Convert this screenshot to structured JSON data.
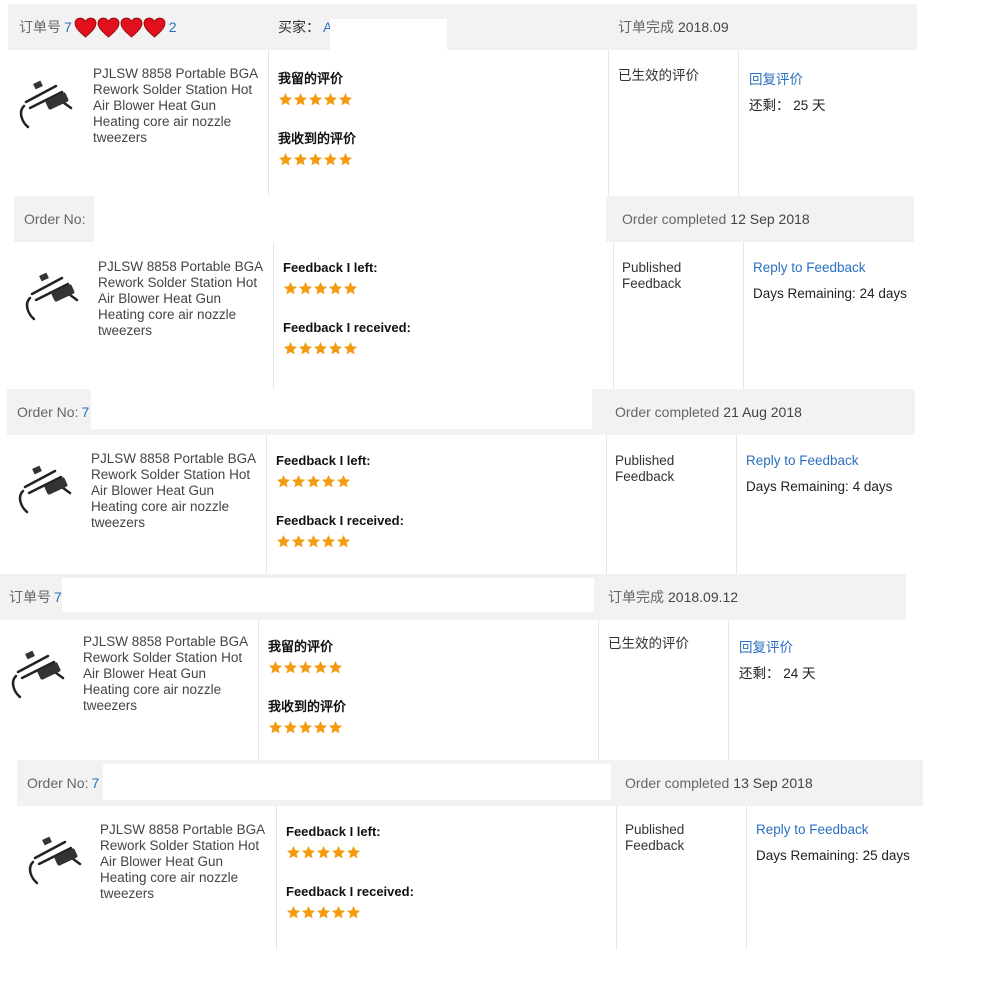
{
  "colors": {
    "link": "#2a6fbf",
    "star": "#f39c12",
    "header_bg": "#f2f2f2",
    "heart": "#e0101e"
  },
  "product_name_lines": [
    "PJLSW 8858 Portable BGA",
    "Rework Solder Station Hot",
    "Air Blower Heat Gun",
    "Heating core air nozzle",
    "tweezers"
  ],
  "orders": [
    {
      "order_label": "订单号",
      "order_value": "7",
      "order_suffix": "2",
      "buyer_label": "买家：",
      "buyer_value": "A",
      "completed_label": "订单完成",
      "completed_date": "2018.09",
      "left_label": "我留的评价",
      "received_label": "我收到的评价",
      "left_stars": 5,
      "received_stars": 5,
      "status": "已生效的评价",
      "reply": "回复评价",
      "remaining_label": "还剩：",
      "remaining_value": "25 天"
    },
    {
      "order_label": "Order No:",
      "order_value": "",
      "completed_label": "Order completed",
      "completed_date": "12 Sep 2018",
      "left_label": "Feedback I left:",
      "received_label": "Feedback I received:",
      "left_stars": 5,
      "received_stars": 5,
      "status": "Published Feedback",
      "reply": "Reply to Feedback",
      "remaining_label": "Days Remaining:",
      "remaining_value": "24 days"
    },
    {
      "order_label": "Order No:",
      "order_value": "7",
      "completed_label": "Order completed",
      "completed_date": "21 Aug 2018",
      "left_label": "Feedback I left:",
      "received_label": "Feedback I received:",
      "left_stars": 5,
      "received_stars": 5,
      "status": "Published Feedback",
      "reply": "Reply to Feedback",
      "remaining_label": "Days Remaining:",
      "remaining_value": "4 days"
    },
    {
      "order_label": "订单号",
      "order_value": "7",
      "completed_label": "订单完成",
      "completed_date": "2018.09.12",
      "left_label": "我留的评价",
      "received_label": "我收到的评价",
      "left_stars": 5,
      "received_stars": 5,
      "status": "已生效的评价",
      "reply": "回复评价",
      "remaining_label": "还剩：",
      "remaining_value": "24 天"
    },
    {
      "order_label": "Order No:",
      "order_value": "7",
      "completed_label": "Order completed",
      "completed_date": "13 Sep 2018",
      "left_label": "Feedback I left:",
      "received_label": "Feedback I received:",
      "left_stars": 5,
      "received_stars": 5,
      "status": "Published Feedback",
      "reply": "Reply to Feedback",
      "remaining_label": "Days Remaining:",
      "remaining_value": "25 days"
    }
  ]
}
